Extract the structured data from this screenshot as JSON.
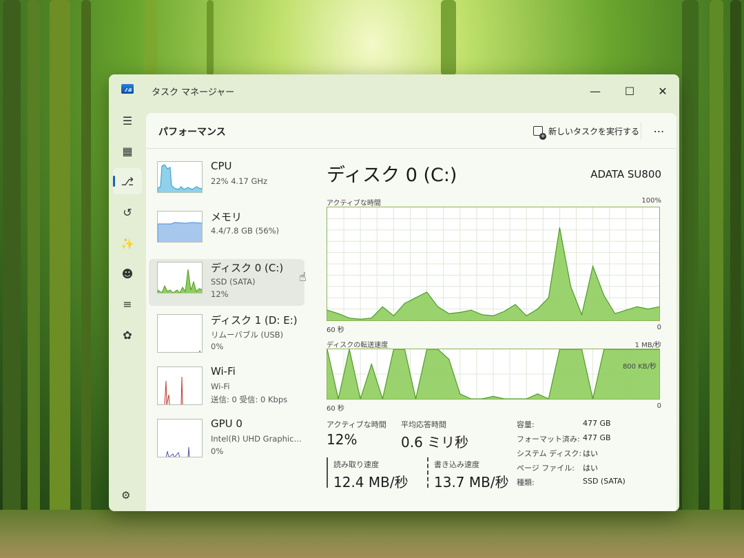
{
  "window": {
    "title": "タスク マネージャー"
  },
  "header": {
    "title": "パフォーマンス",
    "run_task": "新しいタスクを実行する"
  },
  "resources": [
    {
      "name": "CPU",
      "line1": "22%  4.17 GHz",
      "line2": ""
    },
    {
      "name": "メモリ",
      "line1": "4.4/7.8 GB (56%)",
      "line2": ""
    },
    {
      "name": "ディスク 0 (C:)",
      "line1": "SSD (SATA)",
      "line2": "12%"
    },
    {
      "name": "ディスク 1 (D: E:)",
      "line1": "リムーバブル (USB)",
      "line2": "0%"
    },
    {
      "name": "Wi-Fi",
      "line1": "Wi-Fi",
      "line2": "送信: 0  受信: 0 Kbps"
    },
    {
      "name": "GPU 0",
      "line1": "Intel(R) UHD Graphics ...",
      "line2": "0%"
    }
  ],
  "detail": {
    "title": "ディスク 0 (C:)",
    "model": "ADATA SU800",
    "chart1": {
      "label": "アクティブな時間",
      "max": "100%",
      "x_left": "60 秒",
      "x_right": "0"
    },
    "chart2": {
      "label": "ディスクの転送速度",
      "max": "1 MB/秒",
      "mid": "800 KB/秒",
      "x_left": "60 秒",
      "x_right": "0"
    },
    "stats": {
      "active_label": "アクティブな時間",
      "active_value": "12%",
      "resp_label": "平均応答時間",
      "resp_value": "0.6 ミリ秒",
      "read_label": "読み取り速度",
      "read_value": "12.4 MB/秒",
      "write_label": "書き込み速度",
      "write_value": "13.7 MB/秒"
    },
    "props": [
      {
        "k": "容量:",
        "v": "477 GB"
      },
      {
        "k": "フォーマット済み:",
        "v": "477 GB"
      },
      {
        "k": "システム ディスク:",
        "v": "はい"
      },
      {
        "k": "ページ ファイル:",
        "v": "はい"
      },
      {
        "k": "種類:",
        "v": "SSD (SATA)"
      }
    ]
  },
  "chart_data": [
    {
      "type": "area",
      "title": "アクティブな時間",
      "ylim": [
        0,
        100
      ],
      "x": [
        60,
        58,
        56,
        54,
        52,
        50,
        48,
        46,
        44,
        42,
        40,
        38,
        36,
        34,
        32,
        30,
        28,
        26,
        24,
        22,
        20,
        18,
        16,
        14,
        12,
        10,
        8,
        6,
        4,
        2,
        0
      ],
      "series": [
        {
          "values": [
            9,
            6,
            2,
            1,
            2,
            12,
            4,
            15,
            20,
            25,
            12,
            6,
            7,
            9,
            5,
            4,
            8,
            14,
            4,
            10,
            20,
            82,
            30,
            5,
            48,
            22,
            6,
            9,
            12,
            10,
            12
          ]
        }
      ]
    },
    {
      "type": "area",
      "title": "ディスクの転送速度",
      "ylim": [
        0,
        1
      ],
      "x": [
        60,
        58,
        56,
        54,
        52,
        50,
        48,
        46,
        44,
        42,
        40,
        38,
        36,
        34,
        32,
        30,
        28,
        26,
        24,
        22,
        20,
        18,
        16,
        14,
        12,
        10,
        8,
        6,
        4,
        2,
        0
      ],
      "series": [
        {
          "values": [
            1,
            0,
            1,
            0,
            0.7,
            0,
            1,
            1,
            0,
            1,
            1,
            0.8,
            0.1,
            0,
            0,
            0.05,
            0,
            0,
            0,
            0.1,
            0,
            1,
            1,
            1,
            0,
            1,
            1,
            1,
            1,
            1,
            1
          ]
        }
      ]
    }
  ],
  "colors": {
    "accent": "#1b5fc4",
    "disk_green": "#8fce5e",
    "disk_line": "#4f9a2a",
    "cpu": "#2a9fc9",
    "memory": "#4a8bd6"
  }
}
